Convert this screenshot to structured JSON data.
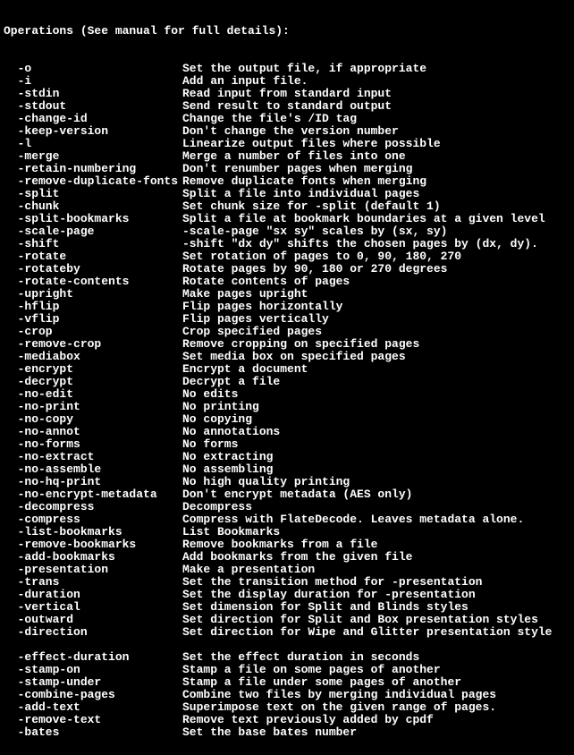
{
  "header": "Operations (See manual for full details):",
  "fill": "  ",
  "options": [
    {
      "flag": "-o",
      "desc": "Set the output file, if appropriate"
    },
    {
      "flag": "-i",
      "desc": "Add an input file."
    },
    {
      "flag": "-stdin",
      "desc": "Read input from standard input"
    },
    {
      "flag": "-stdout",
      "desc": "Send result to standard output"
    },
    {
      "flag": "-change-id",
      "desc": "Change the file's /ID tag"
    },
    {
      "flag": "-keep-version",
      "desc": "Don't change the version number"
    },
    {
      "flag": "-l",
      "desc": "Linearize output files where possible"
    },
    {
      "flag": "-merge",
      "desc": "Merge a number of files into one"
    },
    {
      "flag": "-retain-numbering",
      "desc": "Don't renumber pages when merging"
    },
    {
      "flag": "-remove-duplicate-fonts",
      "desc": "Remove duplicate fonts when merging"
    },
    {
      "flag": "-split",
      "desc": "Split a file into individual pages"
    },
    {
      "flag": "-chunk",
      "desc": "Set chunk size for -split (default 1)"
    },
    {
      "flag": "-split-bookmarks",
      "desc": "Split a file at bookmark boundaries at a given level"
    },
    {
      "flag": "-scale-page",
      "desc": "-scale-page \"sx sy\" scales by (sx, sy)"
    },
    {
      "flag": "-shift",
      "desc": "-shift \"dx dy\" shifts the chosen pages by (dx, dy)."
    },
    {
      "flag": "-rotate",
      "desc": "Set rotation of pages to 0, 90, 180, 270"
    },
    {
      "flag": "-rotateby",
      "desc": "Rotate pages by 90, 180 or 270 degrees"
    },
    {
      "flag": "-rotate-contents",
      "desc": "Rotate contents of pages"
    },
    {
      "flag": "-upright",
      "desc": "Make pages upright"
    },
    {
      "flag": "-hflip",
      "desc": "Flip pages horizontally"
    },
    {
      "flag": "-vflip",
      "desc": "Flip pages vertically"
    },
    {
      "flag": "-crop",
      "desc": "Crop specified pages"
    },
    {
      "flag": "-remove-crop",
      "desc": "Remove cropping on specified pages"
    },
    {
      "flag": "-mediabox",
      "desc": "Set media box on specified pages"
    },
    {
      "flag": "-encrypt",
      "desc": "Encrypt a document"
    },
    {
      "flag": "-decrypt",
      "desc": "Decrypt a file"
    },
    {
      "flag": "-no-edit",
      "desc": "No edits"
    },
    {
      "flag": "-no-print",
      "desc": "No printing"
    },
    {
      "flag": "-no-copy",
      "desc": "No copying"
    },
    {
      "flag": "-no-annot",
      "desc": "No annotations"
    },
    {
      "flag": "-no-forms",
      "desc": "No forms"
    },
    {
      "flag": "-no-extract",
      "desc": "No extracting"
    },
    {
      "flag": "-no-assemble",
      "desc": "No assembling"
    },
    {
      "flag": "-no-hq-print",
      "desc": "No high quality printing"
    },
    {
      "flag": "-no-encrypt-metadata",
      "desc": "Don't encrypt metadata (AES only)"
    },
    {
      "flag": "-decompress",
      "desc": "Decompress"
    },
    {
      "flag": "-compress",
      "desc": "Compress with FlateDecode. Leaves metadata alone."
    },
    {
      "flag": "-list-bookmarks",
      "desc": "List Bookmarks"
    },
    {
      "flag": "-remove-bookmarks",
      "desc": "Remove bookmarks from a file"
    },
    {
      "flag": "-add-bookmarks",
      "desc": "Add bookmarks from the given file"
    },
    {
      "flag": "-presentation",
      "desc": "Make a presentation"
    },
    {
      "flag": "-trans",
      "desc": "Set the transition method for -presentation"
    },
    {
      "flag": "-duration",
      "desc": "Set the display duration for -presentation"
    },
    {
      "flag": "-vertical",
      "desc": "Set dimension for Split and Blinds styles"
    },
    {
      "flag": "-outward",
      "desc": "Set direction for Split and Box presentation styles"
    },
    {
      "flag": "-direction",
      "desc": "Set direction for Wipe and Glitter presentation style"
    },
    null,
    {
      "flag": "-effect-duration",
      "desc": "Set the effect duration in seconds"
    },
    {
      "flag": "-stamp-on",
      "desc": "Stamp a file on some pages of another"
    },
    {
      "flag": "-stamp-under",
      "desc": "Stamp a file under some pages of another"
    },
    {
      "flag": "-combine-pages",
      "desc": "Combine two files by merging individual pages"
    },
    {
      "flag": "-add-text",
      "desc": "Superimpose text on the given range of pages."
    },
    {
      "flag": "-remove-text",
      "desc": "Remove text previously added by cpdf"
    },
    {
      "flag": "-bates",
      "desc": "Set the base bates number"
    }
  ]
}
